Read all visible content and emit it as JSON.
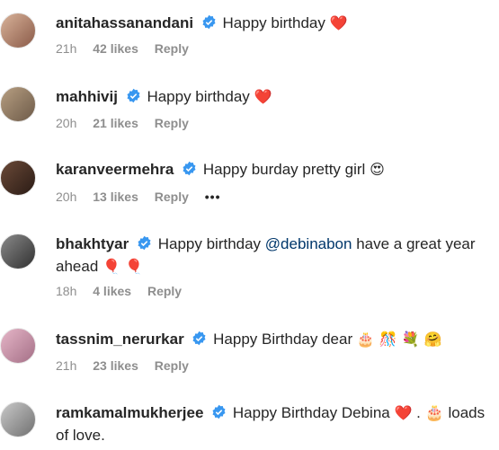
{
  "comments": [
    {
      "username": "anitahassanandani",
      "text": "Happy birthday",
      "emoji": "❤️",
      "time": "21h",
      "likes": "42 likes",
      "reply": "Reply",
      "colors": [
        "#d9b39a",
        "#8a5a48"
      ]
    },
    {
      "username": "mahhivij",
      "text": "Happy birthday",
      "emoji": "❤️",
      "time": "20h",
      "likes": "21 likes",
      "reply": "Reply",
      "colors": [
        "#b79f82",
        "#6d5a48"
      ]
    },
    {
      "username": "karanveermehra",
      "text": "Happy burday pretty girl",
      "emoji": "😍",
      "time": "20h",
      "likes": "13 likes",
      "reply": "Reply",
      "more": "•••",
      "colors": [
        "#6b4a38",
        "#2a1b15"
      ]
    },
    {
      "username": "bhakhtyar",
      "text_before": "Happy birthday",
      "mention": "@debinabon",
      "text_after": "have a great year ahead",
      "emoji": "🎈 🎈",
      "time": "18h",
      "likes": "4 likes",
      "reply": "Reply",
      "colors": [
        "#8a8a8a",
        "#303030"
      ]
    },
    {
      "username": "tassnim_nerurkar",
      "text": "Happy Birthday dear",
      "emoji": "🎂 🎊 💐 🤗",
      "time": "21h",
      "likes": "23 likes",
      "reply": "Reply",
      "colors": [
        "#e6b6c8",
        "#a46f86"
      ]
    },
    {
      "username": "ramkamalmukherjee",
      "text_before": "Happy Birthday Debina",
      "emoji_mid": "❤️",
      "text_after": ". 🎂 loads of love.",
      "colors": [
        "#c9c9c9",
        "#707070"
      ]
    }
  ],
  "theme": {
    "verified": "#3897f0",
    "heart": "#ed4956"
  }
}
